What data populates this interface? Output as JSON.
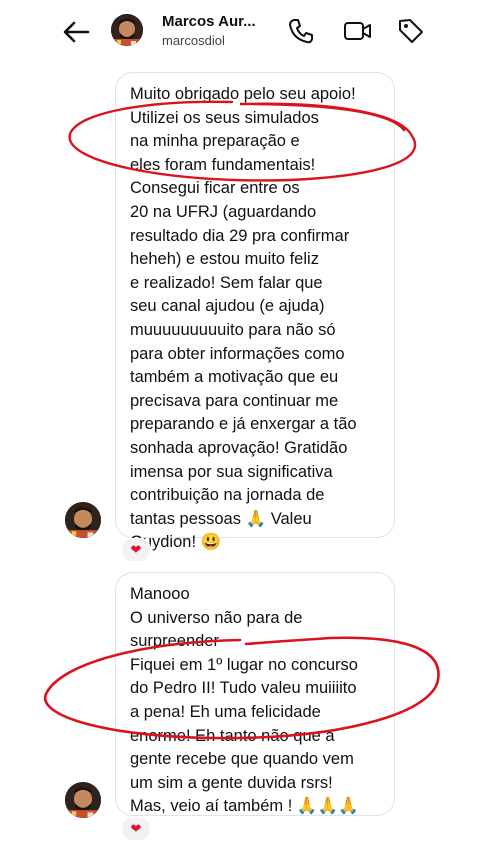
{
  "header": {
    "contact_name": "Marcos Aur...",
    "username": "marcosdiol",
    "icons": [
      "back-arrow-icon",
      "phone-icon",
      "video-camera-icon",
      "tag-icon"
    ]
  },
  "messages": [
    {
      "lines": [
        "Muito obrigado pelo seu apoio!",
        "Utilizei os seus simulados",
        "na minha preparação e",
        "eles foram fundamentais!",
        "Consegui ficar entre os",
        "20 na UFRJ (aguardando",
        "resultado dia 29 pra confirmar",
        "heheh) e estou muito feliz",
        "e realizado! Sem falar que",
        "seu canal ajudou (e ajuda)",
        "muuuuuuuuuito para não só",
        "para obter informações como",
        "também a motivação que eu",
        "precisava para continuar me",
        "preparando e já enxergar a tão",
        "sonhada aprovação! Gratidão",
        "imensa por sua significativa",
        "contribuição na jornada de",
        "tantas pessoas 🙏 Valeu",
        "Guydion! 😃"
      ],
      "reaction": "❤"
    },
    {
      "lines": [
        "Manooo",
        "O universo não para de",
        "surpreender",
        "Fiquei em 1º lugar no concurso",
        "do Pedro II! Tudo valeu muiiiito",
        "a pena! Eh uma felicidade",
        "enorme! Eh tanto não que a",
        "gente recebe que quando vem",
        "um sim a gente duvida rsrs!",
        "Mas, veio aí também ! 🙏🙏🙏"
      ],
      "reaction": "❤"
    }
  ],
  "annotation_color": "#d8141c"
}
